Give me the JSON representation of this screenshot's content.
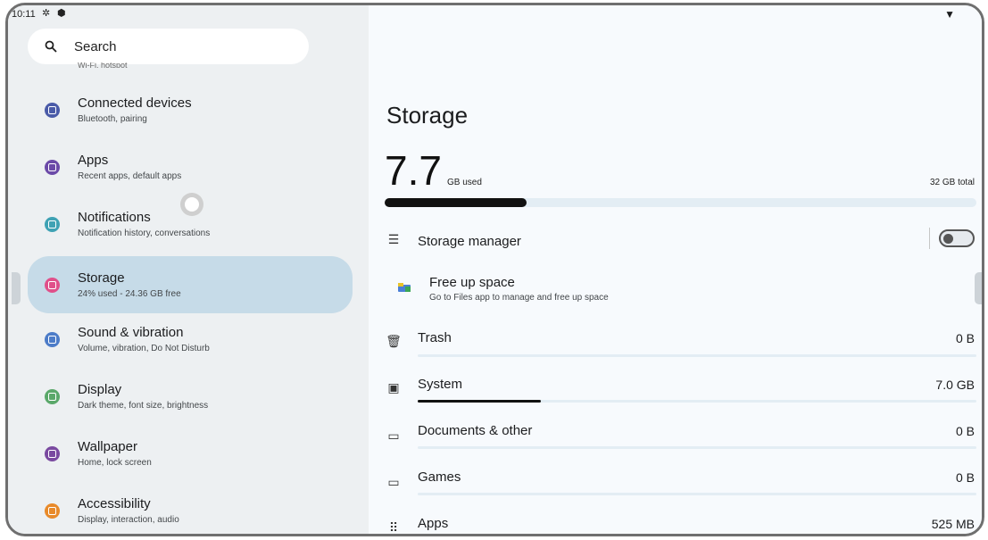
{
  "status": {
    "time": "10:11",
    "icons": [
      "settings-icon",
      "shield-icon",
      "wifi-icon"
    ]
  },
  "left": {
    "search_label": "Search",
    "cut_subtitle": "Wi-Fi, hotspot",
    "items": [
      {
        "title": "Connected devices",
        "subtitle": "Bluetooth, pairing",
        "icon": "devices-icon",
        "color": "#4a5ba8"
      },
      {
        "title": "Apps",
        "subtitle": "Recent apps, default apps",
        "icon": "apps-icon",
        "color": "#6b4aa8"
      },
      {
        "title": "Notifications",
        "subtitle": "Notification history, conversations",
        "icon": "bell-icon",
        "color": "#3fa2b4"
      },
      {
        "title": "Storage",
        "subtitle": "24% used - 24.36 GB free",
        "icon": "storage-icon",
        "color": "#e0508a"
      },
      {
        "title": "Sound & vibration",
        "subtitle": "Volume, vibration, Do Not Disturb",
        "icon": "volume-icon",
        "color": "#4c7cc8"
      },
      {
        "title": "Display",
        "subtitle": "Dark theme, font size, brightness",
        "icon": "display-icon",
        "color": "#5aa86a"
      },
      {
        "title": "Wallpaper",
        "subtitle": "Home, lock screen",
        "icon": "palette-icon",
        "color": "#7a4aa0"
      },
      {
        "title": "Accessibility",
        "subtitle": "Display, interaction, audio",
        "icon": "accessibility-icon",
        "color": "#e88a2a"
      }
    ]
  },
  "storage": {
    "title": "Storage",
    "used_number": "7.7",
    "used_unit": "GB used",
    "total_label": "32 GB total",
    "used_fraction": 0.24,
    "manager_label": "Storage manager",
    "manager_enabled": false,
    "free_up_title": "Free up space",
    "free_up_subtitle": "Go to Files app to manage and free up space",
    "categories": [
      {
        "label": "Trash",
        "value": "0 B",
        "icon": "trash-icon",
        "fraction": 0
      },
      {
        "label": "System",
        "value": "7.0 GB",
        "icon": "system-icon",
        "fraction": 0.22
      },
      {
        "label": "Documents & other",
        "value": "0 B",
        "icon": "folder-icon",
        "fraction": 0
      },
      {
        "label": "Games",
        "value": "0 B",
        "icon": "gamepad-icon",
        "fraction": 0
      },
      {
        "label": "Apps",
        "value": "525 MB",
        "icon": "apps-grid-icon",
        "fraction": 0.02
      }
    ]
  }
}
